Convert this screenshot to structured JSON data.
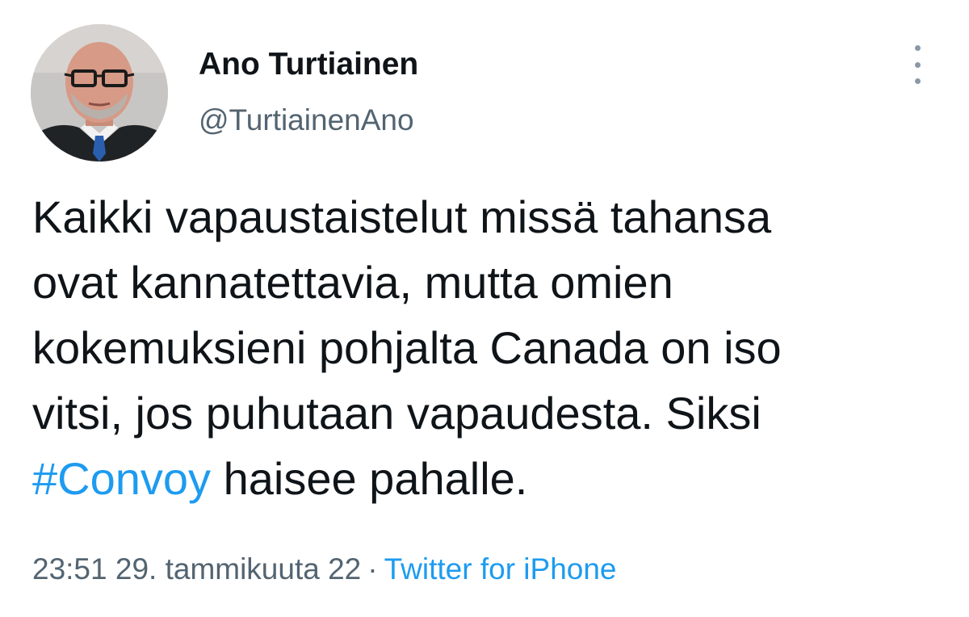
{
  "author": {
    "display_name": "Ano Turtiainen",
    "handle": "@TurtiainenAno"
  },
  "tweet": {
    "lines": [
      "Kaikki vapaustaistelut missä tahansa",
      "ovat kannatettavia, mutta omien",
      "kokemuksieni pohjalta Canada on iso",
      "vitsi, jos puhutaan vapaudesta. Siksi"
    ],
    "hashtag": "#Convoy",
    "last_line_rest": " haisee pahalle."
  },
  "meta": {
    "timestamp": "23:51 29. tammikuuta 22",
    "separator": "·",
    "source": "Twitter for iPhone"
  },
  "colors": {
    "text": "#0f1419",
    "secondary": "#536471",
    "link": "#1d9bf0"
  },
  "icons": {
    "more": "more-vertical-icon"
  }
}
